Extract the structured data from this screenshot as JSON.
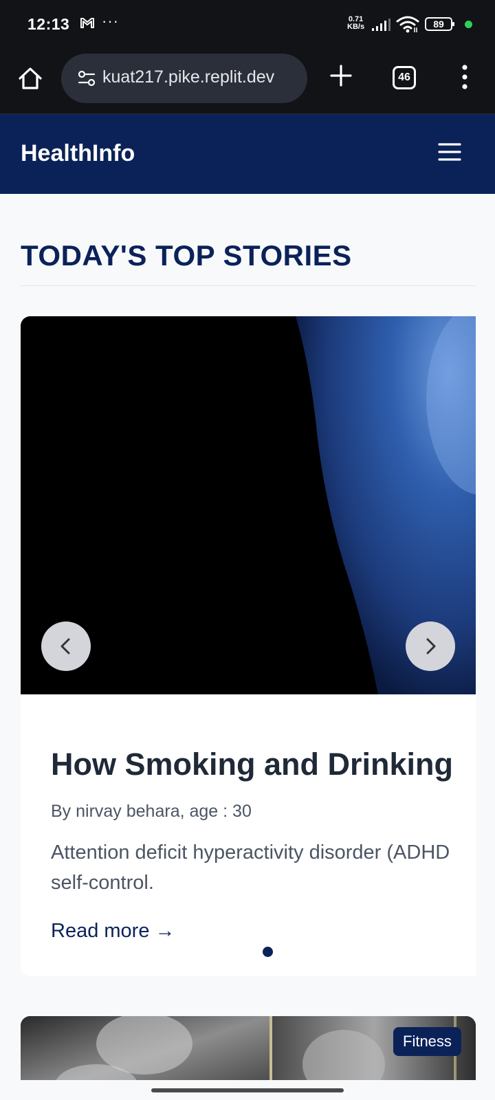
{
  "status_bar": {
    "time": "12:13",
    "overflow": "···",
    "net_speed_value": "0.71",
    "net_speed_unit": "KB/s",
    "battery": "89",
    "mail_icon": "gmail-icon",
    "signal_icon": "cellular-signal-icon",
    "wifi_icon": "wifi-icon",
    "battery_icon": "battery-icon"
  },
  "browser": {
    "url": "kuat217.pike.replit.dev",
    "tab_count": "46",
    "icons": [
      "home-icon",
      "site-settings-icon",
      "new-tab-icon",
      "tab-switcher-icon",
      "more-menu-icon"
    ]
  },
  "site": {
    "logo": "HealthInfo",
    "menu_icon": "hamburger-menu-icon"
  },
  "main": {
    "section_title": "TODAY'S TOP STORIES",
    "featured_story": {
      "title": "How Smoking and Drinking",
      "byline": "By nirvay behara, age : 30",
      "excerpt_line1": "Attention deficit hyperactivity disorder (ADHD",
      "excerpt_line2": "self-control.",
      "read_more": "Read more →"
    },
    "carousel": {
      "prev_icon": "chevron-left-icon",
      "next_icon": "chevron-right-icon",
      "active_slide": 1
    },
    "next_card": {
      "category_badge": "Fitness"
    }
  },
  "colors": {
    "brand_navy": "#0b2259",
    "page_bg": "#f8f9fb",
    "status_bar_bg": "#121317",
    "text_dark": "#1f2937",
    "text_muted": "#4b5563"
  }
}
